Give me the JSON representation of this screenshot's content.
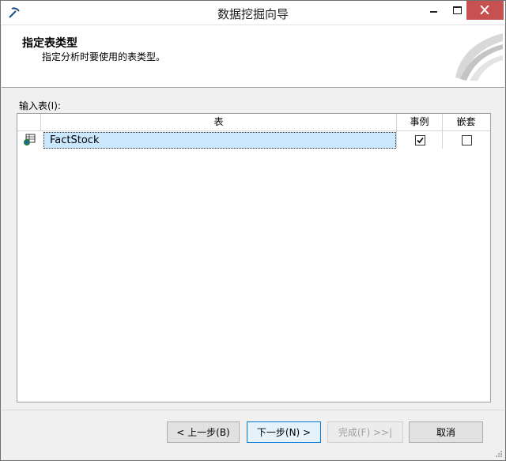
{
  "window": {
    "title": "数据挖掘向导",
    "icon": "pickaxe-icon"
  },
  "header": {
    "title": "指定表类型",
    "subtitle": "指定分析时要使用的表类型。"
  },
  "input_tables": {
    "label": "输入表(I):",
    "columns": {
      "table": "表",
      "case": "事例",
      "nested": "嵌套"
    },
    "rows": [
      {
        "name": "FactStock",
        "case": true,
        "nested": false
      }
    ]
  },
  "buttons": {
    "back": "< 上一步(B)",
    "next": "下一步(N) >",
    "finish": "完成(F) >>|",
    "cancel": "取消"
  },
  "colors": {
    "selection": "#cce8ff",
    "close_button": "#c75050",
    "default_button_border": "#0078d7"
  }
}
